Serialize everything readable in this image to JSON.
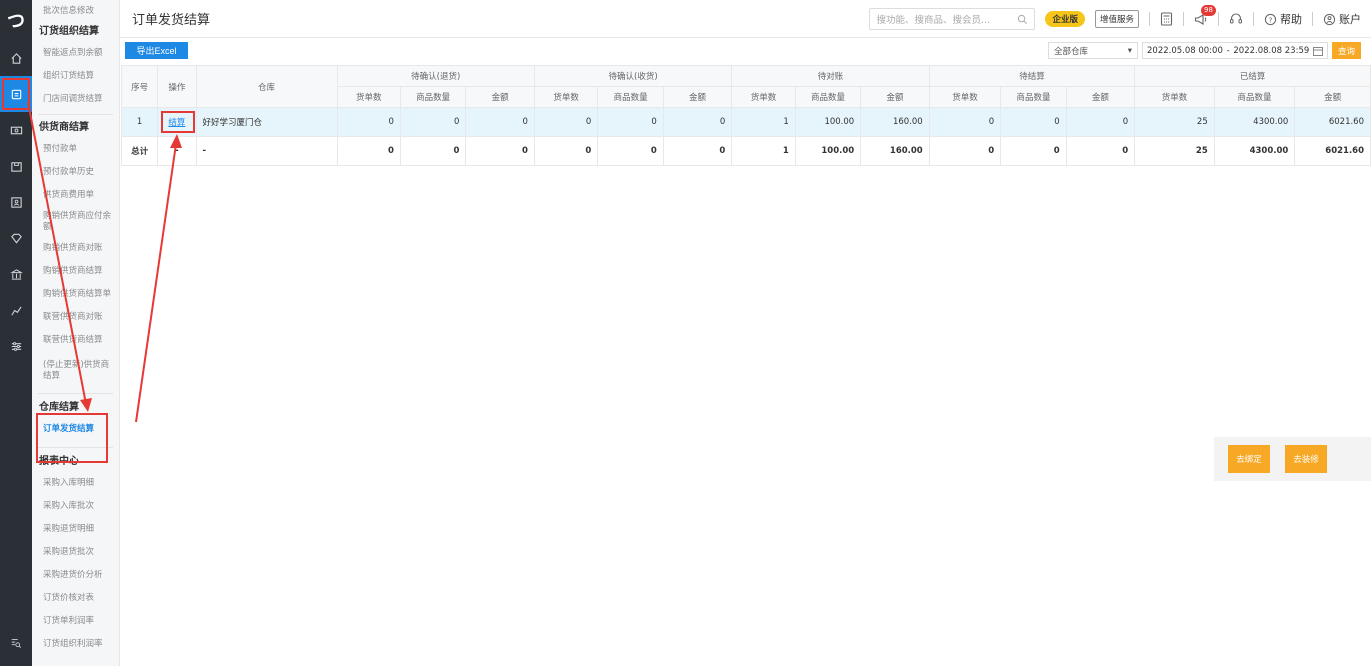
{
  "rail": {
    "logo": "つ",
    "bottom_icon_name": "menu-search-icon"
  },
  "menu": {
    "top_item": "批次信息修改",
    "groups": {
      "order_org": "订货组织结算",
      "supplier": "供货商结算",
      "warehouse": "仓库结算",
      "report": "报表中心"
    },
    "order_org_items": [
      "智能返点到余额",
      "组织订货结算",
      "门店间调货结算"
    ],
    "supplier_items": [
      "预付款单",
      "预付款单历史",
      "供货商费用单",
      "购销供货商应付余额",
      "购销供货商对账",
      "购销供货商结算",
      "购销供货商结算单",
      "联营供货商对账",
      "联营供货商结算",
      "(停止更新)供货商结算"
    ],
    "warehouse_items": [
      "订单发货结算"
    ],
    "report_items": [
      "采购入库明细",
      "采购入库批次",
      "采购退货明细",
      "采购退货批次",
      "采购进货价分析",
      "订货价核对表",
      "订货单利润率",
      "订货组织利润率"
    ]
  },
  "topbar": {
    "title": "订单发货结算",
    "search_placeholder": "搜功能、搜商品、搜会员...",
    "edition_badge": "企业版",
    "value_service": "增值服务",
    "notification_count": "98",
    "help": "帮助",
    "account": "账户"
  },
  "toolbar": {
    "export_label": "导出Excel",
    "warehouse_select": "全部仓库",
    "date_start": "2022.05.08 00:00",
    "date_sep": "-",
    "date_end": "2022.08.08 23:59",
    "query_label": "查询"
  },
  "table": {
    "head_fixed": [
      "序号",
      "操作",
      "仓库"
    ],
    "groups": [
      "待确认(退货)",
      "待确认(收货)",
      "待对账",
      "待结算",
      "已结算"
    ],
    "sub_cols": [
      "货单数",
      "商品数量",
      "金额"
    ],
    "rows": [
      {
        "idx": "1",
        "op": "结算",
        "warehouse": "好好学习厦门仓",
        "vals": [
          "0",
          "0",
          "0",
          "0",
          "0",
          "0",
          "1",
          "100.00",
          "160.00",
          "0",
          "0",
          "0",
          "25",
          "4300.00",
          "6021.60"
        ]
      }
    ],
    "total": {
      "idx": "总计",
      "op": "-",
      "warehouse": "-",
      "vals": [
        "0",
        "0",
        "0",
        "0",
        "0",
        "0",
        "1",
        "100.00",
        "160.00",
        "0",
        "0",
        "0",
        "25",
        "4300.00",
        "6021.60"
      ]
    }
  },
  "float_panel": {
    "bind_label": "去绑定",
    "decorate_label": "去装修"
  },
  "colors": {
    "primary": "#1e88e5",
    "accent": "#f7a825",
    "annotation": "#e53935",
    "rail_bg": "#2b2f36"
  }
}
